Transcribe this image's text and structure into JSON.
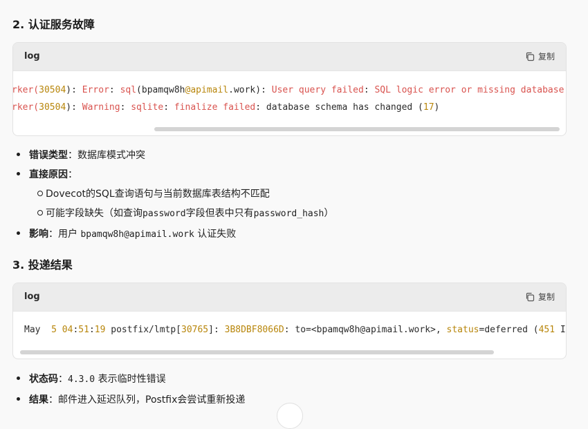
{
  "section2": {
    "title": "2. 认证服务故障",
    "lang": "log",
    "copy_label": "复制",
    "line1": {
      "a": "rker(",
      "b": "30504",
      "c": "): ",
      "d": "Error",
      "e": ": ",
      "f": "sql",
      "g": "(bpamqw8h",
      "h": "@apimail",
      "i": ".work): ",
      "j": "User query failed",
      "k": ": ",
      "l": "SQL logic error or missing database"
    },
    "line2": {
      "a": "rker(",
      "b": "30504",
      "c": "): ",
      "d": "Warning",
      "e": ": ",
      "f": "sqlite",
      "g": ": ",
      "h": "finalize failed",
      "i": ": database schema has changed (",
      "j": "17",
      "k": ")"
    },
    "bullets": {
      "b1_label": "错误类型",
      "b1_text": "：数据库模式冲突",
      "b2_label": "直接原因",
      "b2_text": "：",
      "sub1": "Dovecot的SQL查询语句与当前数据库表结构不匹配",
      "sub2_a": "可能字段缺失（如查询",
      "sub2_b": "password",
      "sub2_c": "字段但表中只有",
      "sub2_d": "password_hash",
      "sub2_e": "）",
      "b3_label": "影响",
      "b3_a": "：用户 ",
      "b3_b": "bpamqw8h@apimail.work",
      "b3_c": " 认证失败"
    }
  },
  "section3": {
    "title": "3. 投递结果",
    "lang": "log",
    "copy_label": "复制",
    "line1": {
      "a": "May  ",
      "b": "5",
      "c": " ",
      "d": "04",
      "e": ":",
      "f": "51",
      "g": ":",
      "h": "19",
      "i": " postfix/lmtp[",
      "j": "30765",
      "k": "]: ",
      "l": "3B8DBF8066D",
      "m": ": to=<bpamqw8h@apimail.work>, ",
      "n": "status",
      "o": "=deferred (",
      "p": "451",
      "q": " Int"
    },
    "bullets": {
      "b1_label": "状态码",
      "b1_a": "：",
      "b1_b": "4.3.0",
      "b1_c": " 表示临时性错误",
      "b2_label": "结果",
      "b2_text": "：邮件进入延迟队列，Postfix会尝试重新投递"
    }
  },
  "colors": {
    "error_red": "#d9534f",
    "number_gold": "#b8860b",
    "background": "#f9f9f9"
  },
  "icons": {
    "copy": "copy-icon"
  }
}
